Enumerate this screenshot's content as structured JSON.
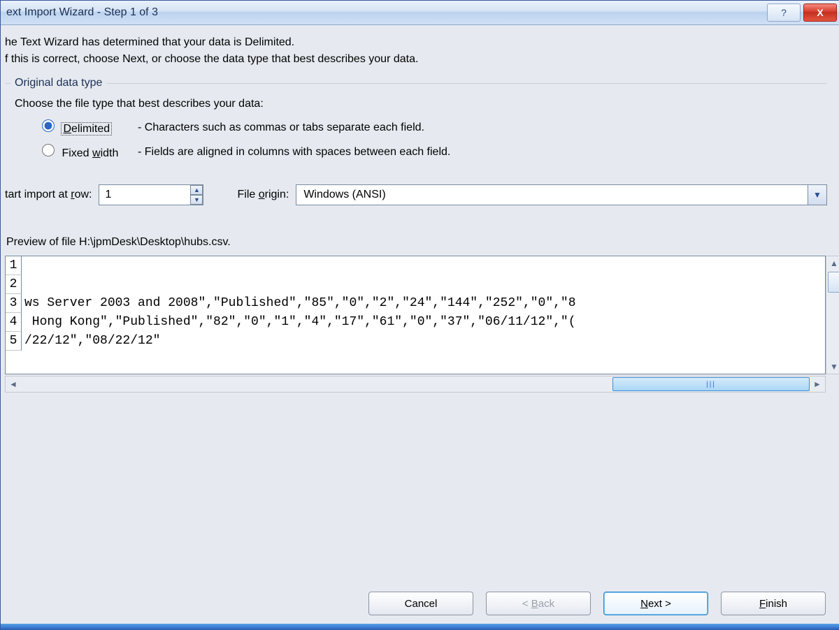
{
  "window": {
    "title": "ext Import Wizard - Step 1 of 3"
  },
  "intro": {
    "line1": "he Text Wizard has determined that your data is Delimited.",
    "line2": "f this is correct, choose Next, or choose the data type that best describes your data."
  },
  "group": {
    "legend": "Original data type",
    "hint": "Choose the file type that best describes your data:",
    "delimited_label": "Delimited",
    "delimited_desc": "- Characters such as commas or tabs separate each field.",
    "fixed_label": "Fixed width",
    "fixed_desc": "- Fields are aligned in columns with spaces between each field."
  },
  "row": {
    "start_label": "tart import at row:",
    "start_value": "1",
    "origin_label": "File origin:",
    "origin_value": "Windows (ANSI)"
  },
  "preview": {
    "label": "Preview of file H:\\jpmDesk\\Desktop\\hubs.csv.",
    "lines": [
      {
        "n": "1",
        "t": ""
      },
      {
        "n": "2",
        "t": ""
      },
      {
        "n": "3",
        "t": "ws Server 2003 and 2008\",\"Published\",\"85\",\"0\",\"2\",\"24\",\"144\",\"252\",\"0\",\"8"
      },
      {
        "n": "4",
        "t": " Hong Kong\",\"Published\",\"82\",\"0\",\"1\",\"4\",\"17\",\"61\",\"0\",\"37\",\"06/11/12\",\"("
      },
      {
        "n": "5",
        "t": "/22/12\",\"08/22/12\""
      }
    ]
  },
  "buttons": {
    "cancel": "Cancel",
    "back": "< Back",
    "next": "Next >",
    "finish": "Finish"
  }
}
